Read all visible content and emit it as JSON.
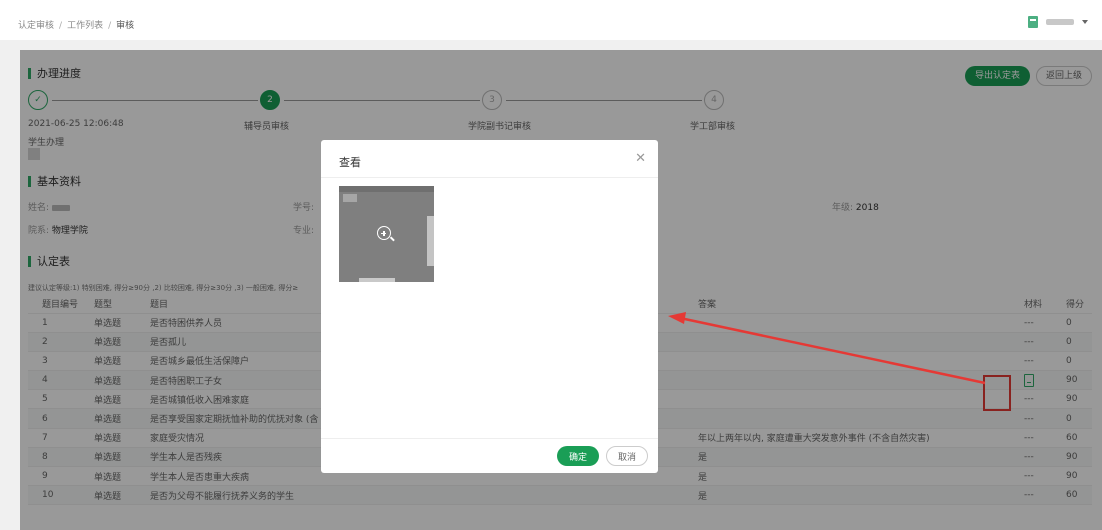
{
  "breadcrumb": {
    "items": [
      "认定审核",
      "工作列表",
      "审核"
    ],
    "separator": "/"
  },
  "header": {
    "export_label": "导出认定表",
    "back_label": "返回上级"
  },
  "progress": {
    "title": "办理进度",
    "steps": [
      {
        "marker": "✓",
        "label": "2021-06-25 12:06:48",
        "sub": "学生办理",
        "state": "done"
      },
      {
        "marker": "2",
        "label": "辅导员审核",
        "state": "active"
      },
      {
        "marker": "3",
        "label": "学院副书记审核",
        "state": "todo"
      },
      {
        "marker": "4",
        "label": "学工部审核",
        "state": "todo"
      }
    ]
  },
  "basic": {
    "title": "基本资料",
    "name_label": "姓名:",
    "student_no_label": "学号:",
    "grade_label": "年级:",
    "grade_value": "2018",
    "dept_label": "院系:",
    "dept_value": "物理学院",
    "major_label": "专业:"
  },
  "form": {
    "title": "认定表",
    "hint": "建议认定等级:1) 特别困难, 得分≥90分 ,2) 比较困难, 得分≥30分 ,3) 一般困难, 得分≥",
    "headers": [
      "题目编号",
      "题型",
      "题目",
      "答案",
      "材料",
      "得分"
    ],
    "rows": [
      {
        "no": "1",
        "type": "单选题",
        "title": "是否特困供养人员",
        "answer": "",
        "material": "---",
        "score": "0"
      },
      {
        "no": "2",
        "type": "单选题",
        "title": "是否孤儿",
        "answer": "",
        "material": "---",
        "score": "0"
      },
      {
        "no": "3",
        "type": "单选题",
        "title": "是否城乡最低生活保障户",
        "answer": "",
        "material": "---",
        "score": "0"
      },
      {
        "no": "4",
        "type": "单选题",
        "title": "是否特困职工子女",
        "answer": "",
        "material": "doc",
        "score": "90"
      },
      {
        "no": "5",
        "type": "单选题",
        "title": "是否城镇低收入困难家庭",
        "answer": "",
        "material": "---",
        "score": "90"
      },
      {
        "no": "6",
        "type": "单选题",
        "title": "是否享受国家定期抚恤补助的优抚对象 (含",
        "answer": "",
        "material": "---",
        "score": "0"
      },
      {
        "no": "7",
        "type": "单选题",
        "title": "家庭受灾情况",
        "answer": "年以上两年以内, 家庭遭重大突发意外事件 (不含自然灾害)",
        "material": "---",
        "score": "60"
      },
      {
        "no": "8",
        "type": "单选题",
        "title": "学生本人是否残疾",
        "answer": "是",
        "material": "---",
        "score": "90"
      },
      {
        "no": "9",
        "type": "单选题",
        "title": "学生本人是否患重大疾病",
        "answer": "是",
        "material": "---",
        "score": "90"
      },
      {
        "no": "10",
        "type": "单选题",
        "title": "是否为父母不能履行抚养义务的学生",
        "answer": "是",
        "material": "---",
        "score": "60"
      }
    ]
  },
  "modal": {
    "title": "查看",
    "ok_label": "确定",
    "cancel_label": "取消"
  },
  "colors": {
    "accent": "#1a9e56",
    "annotation": "#e53935"
  }
}
